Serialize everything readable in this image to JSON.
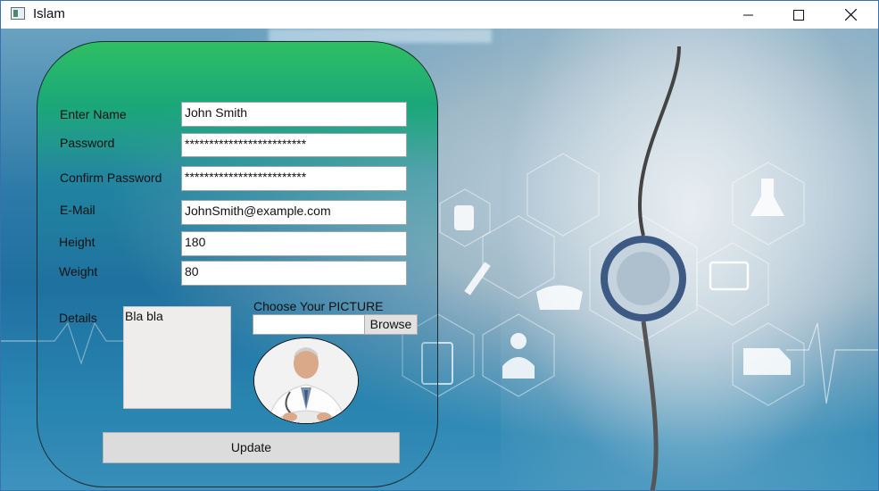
{
  "window": {
    "title": "Islam"
  },
  "titlebar": {
    "icons": [
      "app-icon",
      "minimize-icon",
      "maximize-icon",
      "close-icon"
    ]
  },
  "form": {
    "name": {
      "label": "Enter Name",
      "value": "John Smith"
    },
    "password": {
      "label": "Password",
      "value": "*************************"
    },
    "confirm_password": {
      "label": "Confirm Password",
      "value": "*************************"
    },
    "email": {
      "label": "E-Mail",
      "value": "JohnSmith@example.com"
    },
    "height": {
      "label": "Height",
      "value": "180"
    },
    "weight": {
      "label": "Weight",
      "value": "80"
    },
    "details": {
      "label": "Details",
      "value": "Bla bla"
    },
    "picture": {
      "label": "Choose Your PICTURE",
      "path_value": "",
      "browse_label": "Browse"
    },
    "update_label": "Update"
  },
  "colors": {
    "panel_top": "#2fbf63",
    "background_blue": "#1f6f9f",
    "window_border": "#3a6fb0"
  },
  "background_icons": [
    "iv-bag-icon",
    "syringe-icon",
    "nurse-cap-icon",
    "doctor-icon",
    "clipboard-icon",
    "flask-icon",
    "heart-monitor-icon",
    "ambulance-icon",
    "stethoscope-icon"
  ]
}
